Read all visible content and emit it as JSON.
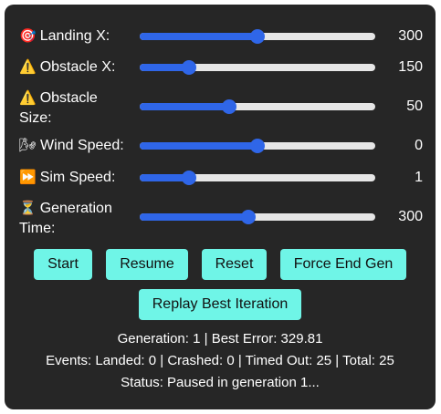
{
  "controls": [
    {
      "icon": "🎯",
      "icon_name": "target-icon",
      "label": "Landing X:",
      "value": "300",
      "fraction": 0.5
    },
    {
      "icon": "⚠️",
      "icon_name": "warning-icon",
      "label": "Obstacle X:",
      "value": "150",
      "fraction": 0.21
    },
    {
      "icon": "⚠️",
      "icon_name": "warning-icon",
      "label_line1": "Obstacle",
      "label_line2": "Size:",
      "value": "50",
      "fraction": 0.38
    },
    {
      "icon": "🌬",
      "icon_name": "wind-icon",
      "label": "Wind Speed:",
      "value": "0",
      "fraction": 0.5
    },
    {
      "icon": "⏩",
      "icon_name": "fast-forward-icon",
      "label": "Sim Speed:",
      "value": "1",
      "fraction": 0.21
    },
    {
      "icon": "⏳",
      "icon_name": "hourglass-icon",
      "label_line1": "Generation",
      "label_line2": "Time:",
      "value": "300",
      "fraction": 0.46
    }
  ],
  "buttons": {
    "start": "Start",
    "resume": "Resume",
    "reset": "Reset",
    "force_end": "Force End Gen",
    "replay": "Replay Best Iteration"
  },
  "info": {
    "generation": "Generation: 1 | Best Error: 329.81",
    "events": "Events: Landed: 0 | Crashed: 0 | Timed Out: 25 | Total: 25",
    "status": "Status: Paused in generation 1..."
  },
  "colors": {
    "panel": "#262626",
    "accent": "#2f66e8",
    "track": "#e6e6e6",
    "button": "#6ff5e7"
  }
}
